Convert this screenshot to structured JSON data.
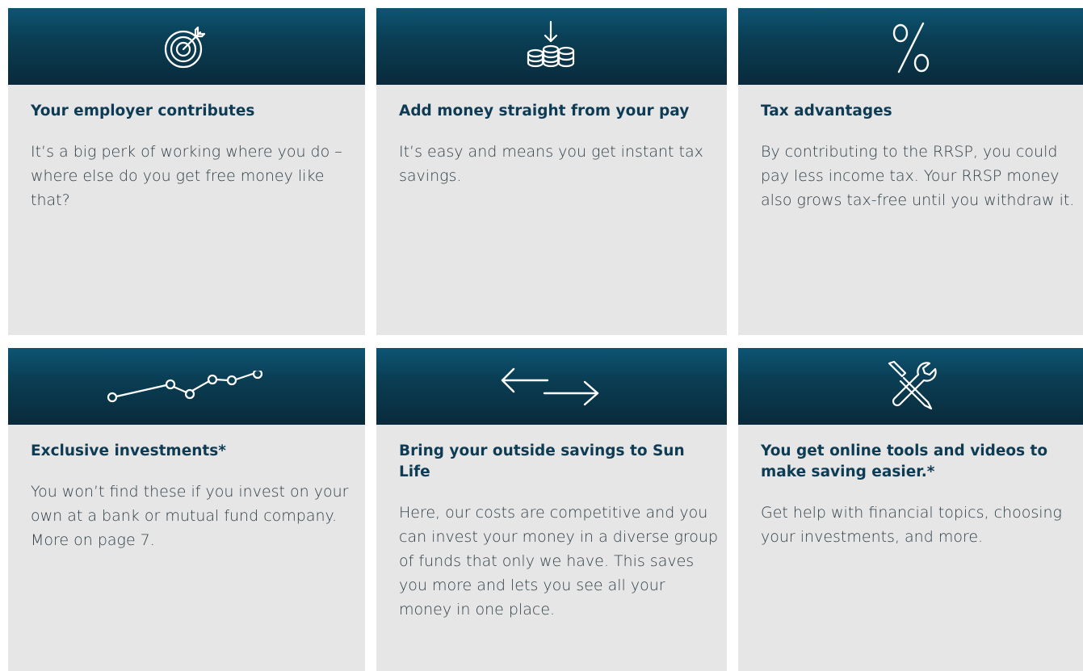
{
  "cards": [
    {
      "icon": "target-icon",
      "title": "Your employer contributes",
      "text": "It’s a big perk of working where you do – where else do you get free money like that?"
    },
    {
      "icon": "coins-deposit-icon",
      "title": "Add money straight from your pay",
      "text": "It’s easy and means you get instant tax savings."
    },
    {
      "icon": "percent-icon",
      "title": "Tax advantages",
      "text": "By contributing to the RRSP, you could pay less income tax. Your RRSP money also grows tax-free until you withdraw it."
    },
    {
      "icon": "trend-line-icon",
      "title": "Exclusive investments*",
      "text": "You won’t find these if you invest on your own at a bank or mutual fund company. More on page 7."
    },
    {
      "icon": "transfer-arrows-icon",
      "title": "Bring your outside savings to Sun Life",
      "text": "Here, our costs are competitive and you can invest your money in a diverse group of funds that only we have. This saves you more and lets you see all your money in one place."
    },
    {
      "icon": "tools-icon",
      "title": "You get online tools and videos to make saving easier.*",
      "text": "Get help with financial topics, choosing your investments, and more."
    }
  ],
  "colors": {
    "header_dark": "#092a3b",
    "header_light": "#0d5574",
    "card_bg": "#e7e6e6",
    "title": "#0d3c54",
    "text": "#2e3e47"
  }
}
